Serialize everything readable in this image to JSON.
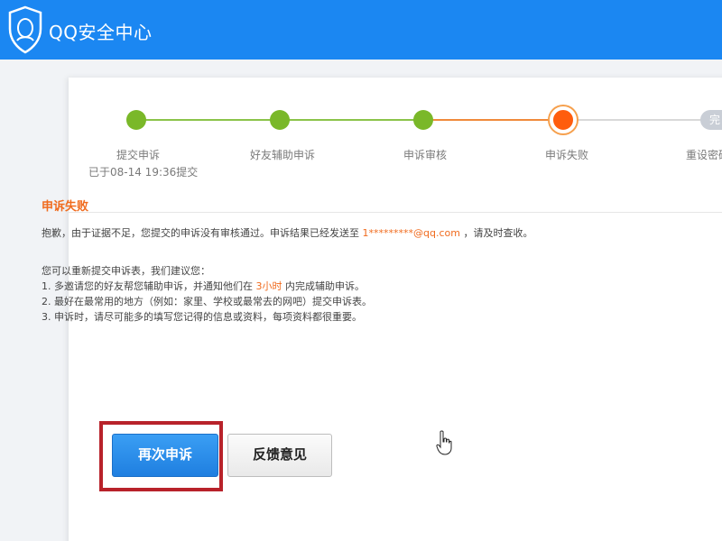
{
  "header": {
    "title": "QQ安全中心",
    "logo_icon": "qq-shield-logo-icon",
    "color": "#1b87f2"
  },
  "progress": {
    "steps": [
      {
        "label": "提交申诉",
        "sub": "已于08-14  19:36提交",
        "state": "done"
      },
      {
        "label": "好友辅助申诉",
        "state": "done"
      },
      {
        "label": "申诉审核",
        "state": "done"
      },
      {
        "label": "申诉失败",
        "state": "failed"
      },
      {
        "label": "重设密码",
        "pending_text": "完",
        "state": "pending"
      }
    ],
    "colors": {
      "done": "#7ab829",
      "failed": "#ff5d0d",
      "pending": "#c9ced6"
    }
  },
  "result": {
    "title": "申诉失败",
    "message_prefix": "抱歉，由于证据不足，您提交的申诉没有审核通过。申诉结果已经发送至",
    "email": "1*********@qq.com",
    "message_suffix": "，请及时查收。",
    "advice_intro": "您可以重新提交申诉表，我们建议您：",
    "advice_1_prefix": "1. 多邀请您的好友帮您辅助申诉，并通知他们在",
    "advice_1_highlight": "3小时",
    "advice_1_suffix": "内完成辅助申诉。",
    "advice_2": "2. 最好在最常用的地方（例如：家里、学校或最常去的网吧）提交申诉表。",
    "advice_3": "3. 申诉时，请尽可能多的填写您记得的信息或资料，每项资料都很重要。",
    "highlight_color": "#f06b1e"
  },
  "actions": {
    "reappeal_label": "再次申诉",
    "feedback_label": "反馈意见"
  },
  "cursor_icon": "hand-pointer-icon"
}
